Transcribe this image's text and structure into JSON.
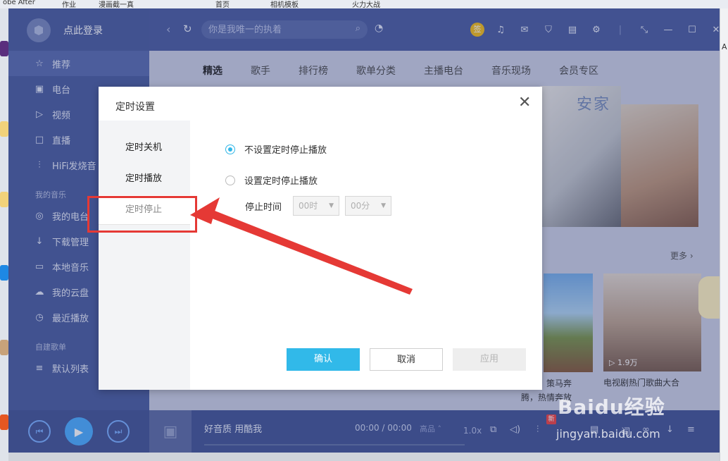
{
  "desktop": {
    "top_items": [
      "obe After",
      "作业",
      "漫画截一真",
      "首页",
      "相机模板",
      "火力大战"
    ],
    "right_letter": "A"
  },
  "app": {
    "login": "点此登录",
    "sidebar": {
      "items": [
        {
          "label": "推荐",
          "icon": "star-icon"
        },
        {
          "label": "电台",
          "icon": "radio-icon"
        },
        {
          "label": "视频",
          "icon": "video-icon"
        },
        {
          "label": "直播",
          "icon": "live-icon"
        },
        {
          "label": "HiFi发烧音",
          "icon": "hifi-icon"
        }
      ],
      "my_music_header": "我的音乐",
      "my_music": [
        {
          "label": "我的电台",
          "icon": "my-radio-icon"
        },
        {
          "label": "下载管理",
          "icon": "download-icon"
        },
        {
          "label": "本地音乐",
          "icon": "local-music-icon"
        },
        {
          "label": "我的云盘",
          "icon": "cloud-icon"
        },
        {
          "label": "最近播放",
          "icon": "clock-icon"
        }
      ],
      "playlist_header": "自建歌单",
      "playlists": [
        {
          "label": "默认列表",
          "icon": "list-icon"
        }
      ]
    },
    "search": {
      "placeholder": "你是我唯一的执着"
    },
    "toolbar": {
      "sign_badge": "签"
    },
    "content": {
      "tabs": [
        "精选",
        "歌手",
        "排行榜",
        "歌单分类",
        "主播电台",
        "音乐现场",
        "会员专区"
      ],
      "active_tab": "精选",
      "banner_title": "安家",
      "more": "更多",
      "card1_caption_lines": [
        "策马奔",
        "腾，热情奔放"
      ],
      "card2_caption": "电视剧热门歌曲大合",
      "card2_plays": "1.9万"
    },
    "player": {
      "title": "好音质 用酷我",
      "time": "00:00 / 00:00",
      "quality": "高品",
      "speed": "1.0x",
      "new_badge": "新"
    }
  },
  "dialog": {
    "title": "定时设置",
    "tabs": [
      "定时关机",
      "定时播放",
      "定时停止"
    ],
    "active_tab": "定时停止",
    "options": [
      {
        "label": "不设置定时停止播放",
        "selected": true
      },
      {
        "label": "设置定时停止播放",
        "selected": false
      }
    ],
    "stop_time_label": "停止时间",
    "hour_value": "00时",
    "minute_value": "00分",
    "confirm": "确认",
    "cancel": "取消",
    "apply": "应用"
  },
  "watermark": {
    "brand": "Baidu经验",
    "url": "jingyan.baidu.com"
  },
  "colors": {
    "accent": "#31b9e9",
    "annotation": "#e53935",
    "app_bg": "#3c4f99"
  }
}
